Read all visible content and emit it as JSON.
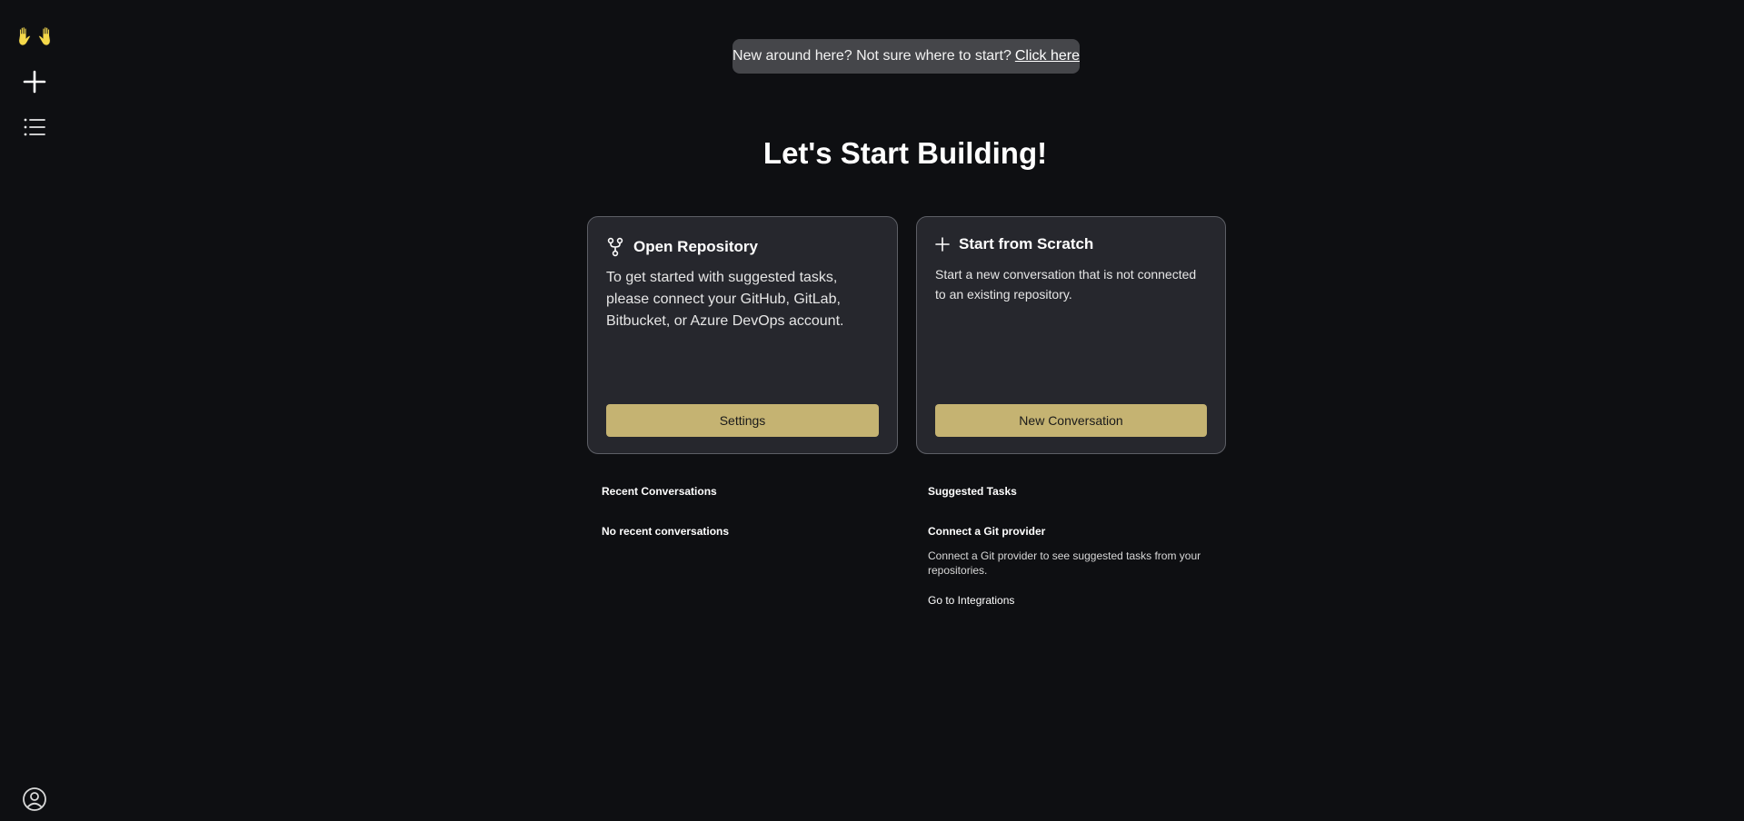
{
  "banner": {
    "text": "New around here? Not sure where to start?",
    "link": "Click here"
  },
  "main": {
    "title": "Let's Start Building!"
  },
  "cards": {
    "repo": {
      "title": "Open Repository",
      "text": "To get started with suggested tasks, please connect your GitHub, GitLab, Bitbucket, or Azure DevOps account.",
      "button": "Settings",
      "icon": "git-fork-icon"
    },
    "scratch": {
      "title": "Start from Scratch",
      "text": "Start a new conversation that is not connected to an existing repository.",
      "button": "New Conversation",
      "icon": "plus-icon"
    }
  },
  "recent": {
    "title": "Recent Conversations",
    "empty": "No recent conversations"
  },
  "suggested": {
    "title": "Suggested Tasks",
    "subtitle": "Connect a Git provider",
    "description": "Connect a Git provider to see suggested tasks from your repositories.",
    "link": "Go to Integrations"
  },
  "sidebar": {
    "icons": [
      "waving-hands-logo-icon",
      "plus-icon",
      "list-icon",
      "user-circle-icon"
    ]
  },
  "colors": {
    "background": "#0e0f12",
    "card": "#26272d",
    "accent": "#c5b372",
    "banner": "#45464a"
  }
}
